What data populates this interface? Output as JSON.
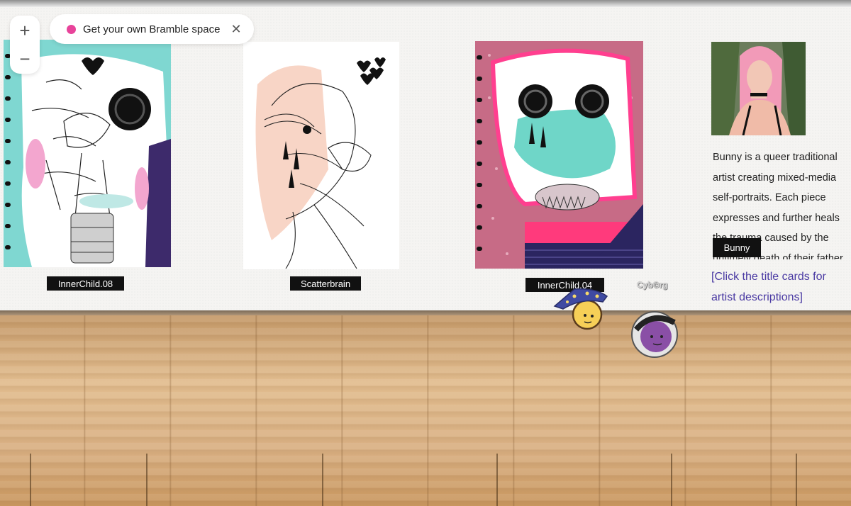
{
  "zoom": {
    "in_symbol": "+",
    "out_symbol": "−"
  },
  "promo": {
    "label": "Get your own Bramble space",
    "close_symbol": "✕",
    "dot_color": "#e8439a"
  },
  "artworks": [
    {
      "title": "InnerChild.08"
    },
    {
      "title": "Scatterbrain"
    },
    {
      "title": "InnerChild.04"
    }
  ],
  "artist": {
    "name": "Bunny",
    "bio": "Bunny is a queer traditional artist creating mixed-media self-portraits. Each piece expresses and further heals the trauma caused by the untimely death of their father",
    "hint": "[Click the title cards for artist descriptions]"
  },
  "users": [
    {
      "name": "Cyb©rg",
      "avatar_icon": "wizard-hat-avatar"
    },
    {
      "avatar_icon": "astronaut-avatar"
    }
  ],
  "colors": {
    "accent": "#e8439a",
    "link": "#4a3aa3",
    "floor": "#dcb488",
    "wall": "#f5f4f2"
  }
}
